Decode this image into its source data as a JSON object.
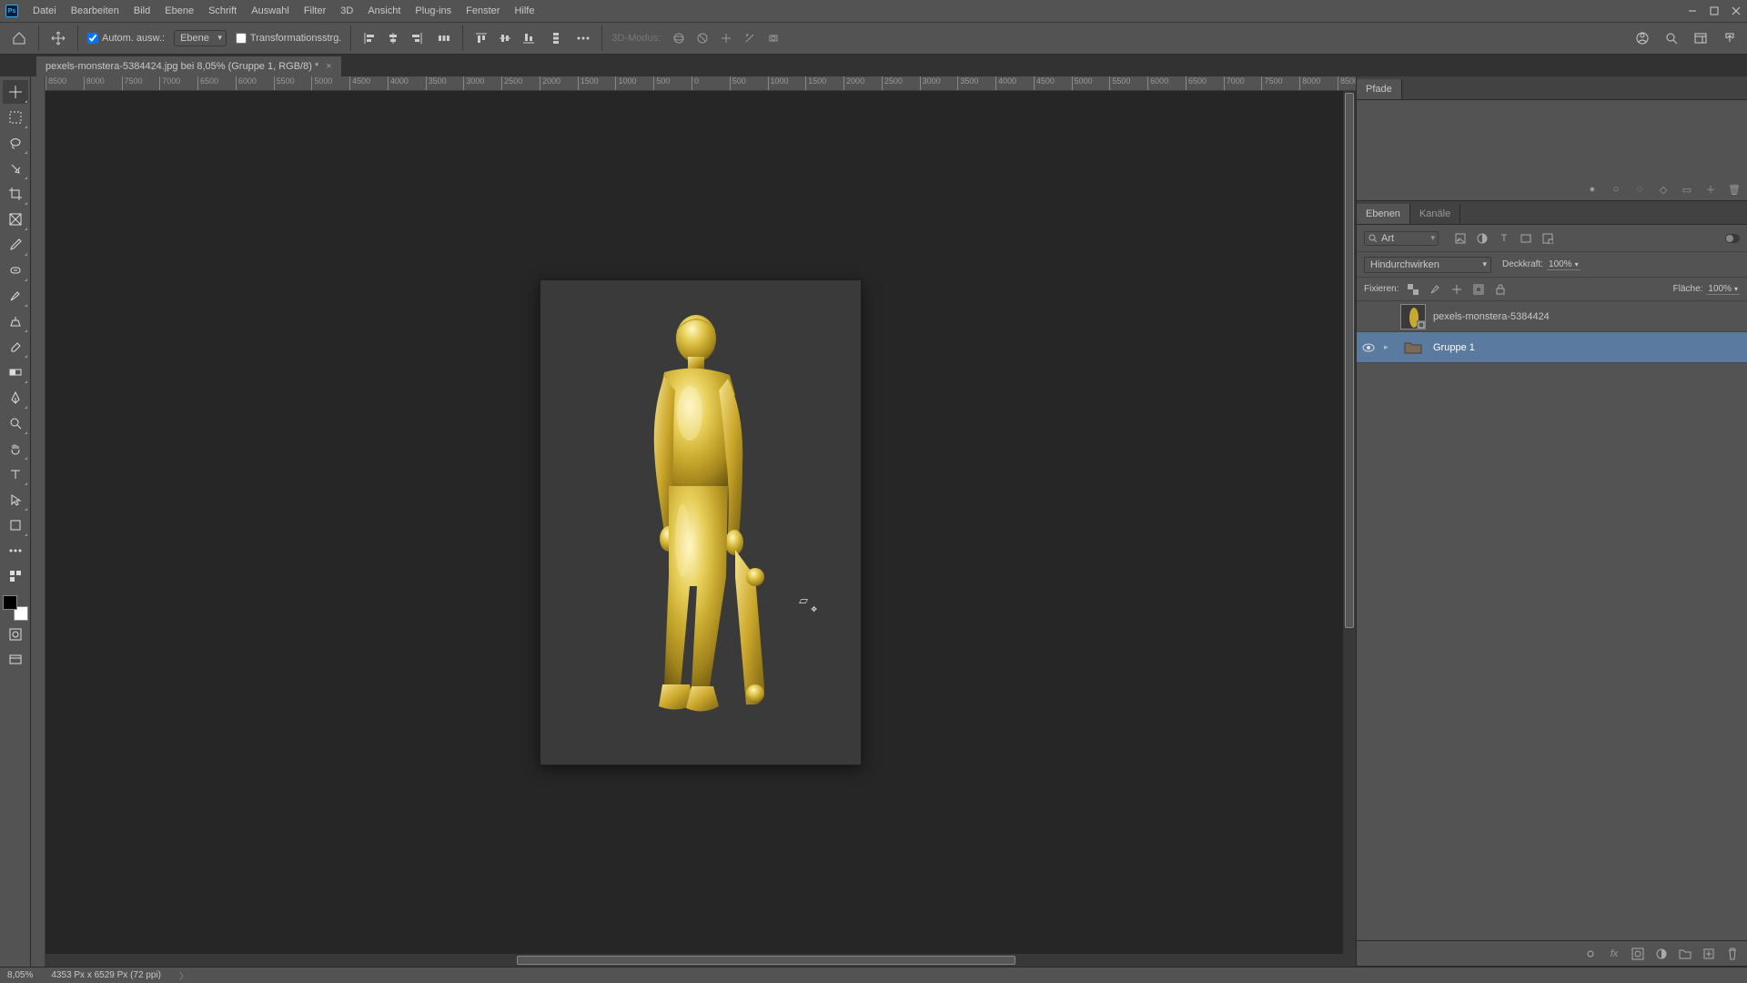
{
  "menu": [
    "Datei",
    "Bearbeiten",
    "Bild",
    "Ebene",
    "Schrift",
    "Auswahl",
    "Filter",
    "3D",
    "Ansicht",
    "Plug-ins",
    "Fenster",
    "Hilfe"
  ],
  "optionsbar": {
    "auto_select_label": "Autom. ausw.:",
    "auto_select_target": "Ebene",
    "transform_controls_label": "Transformationsstrg.",
    "threed_mode_label": "3D-Modus:"
  },
  "doc_tab": "pexels-monstera-5384424.jpg bei 8,05% (Gruppe 1, RGB/8) *",
  "ruler_marks": [
    "8500",
    "8000",
    "7500",
    "7000",
    "6500",
    "6000",
    "5500",
    "5000",
    "4500",
    "4000",
    "3500",
    "3000",
    "2500",
    "2000",
    "1500",
    "1000",
    "500",
    "0",
    "500",
    "1000",
    "1500",
    "2000",
    "2500",
    "3000",
    "3500",
    "4000",
    "4500",
    "5000",
    "5500",
    "6000",
    "6500",
    "7000",
    "7500",
    "8000",
    "8500"
  ],
  "panels": {
    "paths_tab": "Pfade",
    "layers_tab": "Ebenen",
    "channels_tab": "Kanäle",
    "filter_label": "Art",
    "blend_mode": "Hindurchwirken",
    "opacity_label": "Deckkraft:",
    "opacity_value": "100%",
    "lock_label": "Fixieren:",
    "fill_label": "Fläche:",
    "fill_value": "100%"
  },
  "layers": [
    {
      "visible": false,
      "name": "pexels-monstera-5384424",
      "type": "smart"
    },
    {
      "visible": true,
      "name": "Gruppe 1",
      "type": "group",
      "selected": true
    }
  ],
  "status": {
    "zoom": "8,05%",
    "doc_info": "4353 Px x 6529 Px (72 ppi)"
  }
}
